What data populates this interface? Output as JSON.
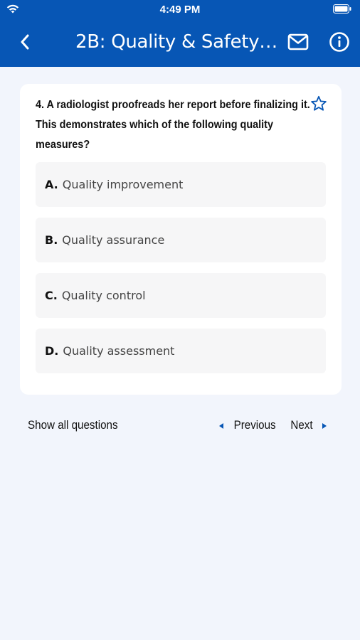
{
  "status_bar": {
    "time": "4:49 PM",
    "icons": [
      "wifi-icon",
      "battery-icon"
    ]
  },
  "header": {
    "title": "2B: Quality & Safety…",
    "back_icon": "chevron-left-icon",
    "mail_icon": "mail-icon",
    "info_icon": "info-icon"
  },
  "question": {
    "text": "4. A radiologist proofreads her report before finalizing it. This demonstrates which of the following quality measures?",
    "bookmark_icon": "star-outline-icon"
  },
  "options": [
    {
      "letter": "A.",
      "text": "Quality improvement"
    },
    {
      "letter": "B.",
      "text": "Quality assurance"
    },
    {
      "letter": "C.",
      "text": "Quality control"
    },
    {
      "letter": "D.",
      "text": "Quality assessment"
    }
  ],
  "footer": {
    "show_all": "Show all questions",
    "previous": "Previous",
    "next": "Next"
  },
  "colors": {
    "brand": "#0756b5",
    "background": "#f2f5fc",
    "card": "#ffffff",
    "option_bg": "#f6f6f7"
  }
}
